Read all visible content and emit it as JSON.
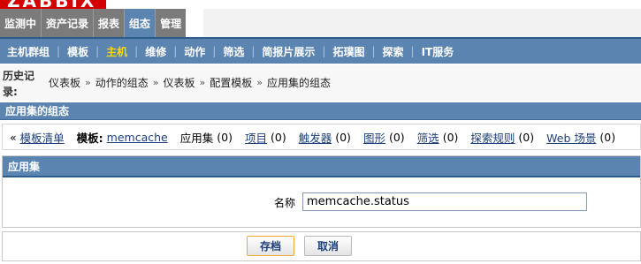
{
  "brand": {
    "logo_text": "ZABBIX"
  },
  "main_tabs": [
    {
      "label": "监测中",
      "active": false
    },
    {
      "label": "资产记录",
      "active": false
    },
    {
      "label": "报表",
      "active": false
    },
    {
      "label": "组态",
      "active": true
    },
    {
      "label": "管理",
      "active": false
    }
  ],
  "sub_tabs": [
    {
      "label": "主机群组",
      "active": false
    },
    {
      "label": "模板",
      "active": false
    },
    {
      "label": "主机",
      "active": true
    },
    {
      "label": "维修",
      "active": false
    },
    {
      "label": "动作",
      "active": false
    },
    {
      "label": "筛选",
      "active": false
    },
    {
      "label": "简报片展示",
      "active": false
    },
    {
      "label": "拓璞图",
      "active": false
    },
    {
      "label": "探索",
      "active": false
    },
    {
      "label": "IT服务",
      "active": false
    }
  ],
  "breadcrumb": {
    "label": "历史记录:",
    "items": [
      "仪表板",
      "动作的组态",
      "仪表板",
      "配置模板",
      "应用集的组态"
    ]
  },
  "section_title": "应用集的组态",
  "nav": {
    "back_link": "模板清单",
    "template_label": "模板:",
    "template_name": "memcache",
    "applications_label": "应用集",
    "applications_count": "(0)",
    "items_label": "项目",
    "items_count": "(0)",
    "triggers_label": "触发器",
    "triggers_count": "(0)",
    "graphs_label": "图形",
    "graphs_count": "(0)",
    "screens_label": "筛选",
    "screens_count": "(0)",
    "discovery_label": "探索规则",
    "discovery_count": "(0)",
    "web_label": "Web 场景",
    "web_count": "(0)"
  },
  "form": {
    "header": "应用集",
    "name_label": "名称",
    "name_value": "memcache.status"
  },
  "buttons": {
    "save_label": "存档",
    "cancel_label": "取消"
  },
  "colors": {
    "header_blue": "#5b84b0",
    "tab_gray": "#7b7b7b",
    "active_subtab": "#ffd700",
    "logo_red": "#d40000"
  }
}
